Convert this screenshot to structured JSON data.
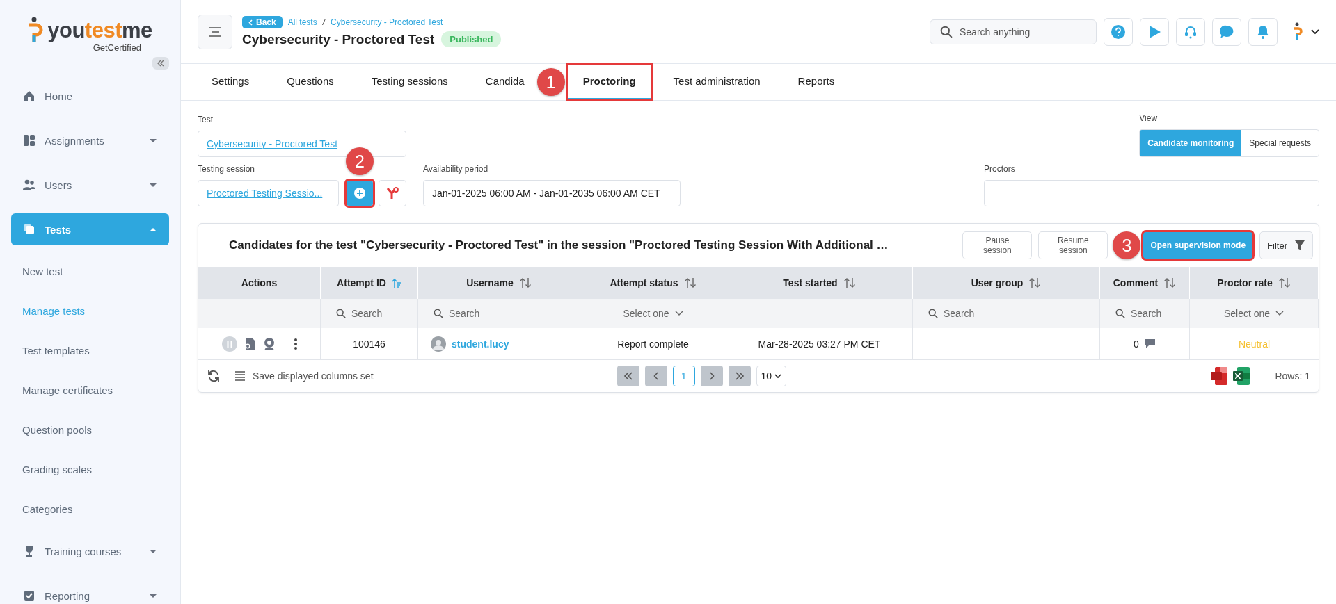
{
  "sidebar": {
    "brand": {
      "parts": [
        "you",
        "test",
        "me"
      ],
      "tagline": "GetCertified"
    },
    "items": [
      {
        "label": "Home",
        "selected": false
      },
      {
        "label": "Assignments",
        "selected": false,
        "expanded": false
      },
      {
        "label": "Users",
        "selected": false,
        "expanded": false
      },
      {
        "label": "Tests",
        "selected": true,
        "expanded": true,
        "children": [
          {
            "label": "New test",
            "selected": false
          },
          {
            "label": "Manage tests",
            "selected": true
          },
          {
            "label": "Test templates",
            "selected": false
          },
          {
            "label": "Manage certificates",
            "selected": false
          },
          {
            "label": "Question pools",
            "selected": false
          },
          {
            "label": "Grading scales",
            "selected": false
          },
          {
            "label": "Categories",
            "selected": false
          }
        ]
      },
      {
        "label": "Training courses",
        "selected": false,
        "expanded": false
      },
      {
        "label": "Reporting",
        "selected": false,
        "expanded": false
      }
    ]
  },
  "header": {
    "back": "Back",
    "breadcrumb": [
      "All tests",
      "/",
      "Cybersecurity - Proctored Test"
    ],
    "title": "Cybersecurity - Proctored Test",
    "status": "Published",
    "search": {
      "placeholder": "Search anything"
    }
  },
  "tabs": [
    {
      "label": "Settings",
      "selected": false
    },
    {
      "label": "Questions",
      "selected": false
    },
    {
      "label": "Testing sessions",
      "selected": false
    },
    {
      "label": "Candida",
      "selected": false
    },
    {
      "label": "Proctoring",
      "selected": true,
      "callout": "1"
    },
    {
      "label": "Test administration",
      "selected": false
    },
    {
      "label": "Reports",
      "selected": false
    }
  ],
  "form": {
    "test": {
      "label": "Test",
      "value": "Cybersecurity - Proctored Test"
    },
    "view": {
      "label": "View",
      "options": [
        {
          "label": "Candidate monitoring",
          "selected": true
        },
        {
          "label": "Special requests",
          "selected": false
        }
      ]
    },
    "session": {
      "label": "Testing session",
      "value": "Proctored Testing Sessio...",
      "add_callout": "2"
    },
    "availability": {
      "label": "Availability period",
      "value": "Jan-01-2025 06:00 AM - Jan-01-2035 06:00 AM CET"
    },
    "proctors": {
      "label": "Proctors"
    }
  },
  "table": {
    "title": "Candidates for the test \"Cybersecurity - Proctored Test\" in the session \"Proctored Testing Session With Additional …",
    "buttons": [
      {
        "label": "Pause session",
        "kind": "plain"
      },
      {
        "label": "Resume session",
        "kind": "plain"
      },
      {
        "label": "Open supervision mode",
        "kind": "primary",
        "callout": "3"
      },
      {
        "label": "Filter",
        "kind": "filter"
      }
    ],
    "columns": [
      {
        "label": "Actions",
        "filter": {
          "kind": "none"
        }
      },
      {
        "label": "Attempt ID",
        "sorted": true,
        "filter": {
          "kind": "search",
          "placeholder": "Search"
        }
      },
      {
        "label": "Username",
        "sorted": false,
        "filter": {
          "kind": "search",
          "placeholder": "Search"
        }
      },
      {
        "label": "Attempt status",
        "sorted": false,
        "filter": {
          "kind": "select",
          "placeholder": "Select one"
        }
      },
      {
        "label": "Test started",
        "sorted": false,
        "filter": {
          "kind": "none"
        }
      },
      {
        "label": "User group",
        "sorted": false,
        "filter": {
          "kind": "search",
          "placeholder": "Search"
        }
      },
      {
        "label": "Comment",
        "sorted": false,
        "filter": {
          "kind": "search",
          "placeholder": "Search"
        }
      },
      {
        "label": "Proctor rate",
        "sorted": false,
        "filter": {
          "kind": "select",
          "placeholder": "Select one"
        }
      }
    ],
    "rows": [
      {
        "attempt_id": "100146",
        "username": "student.lucy",
        "status": "Report complete",
        "started": "Mar-28-2025 03:27 PM CET",
        "comments": "0",
        "rate": "Neutral"
      }
    ],
    "footer": {
      "save_columns": "Save displayed columns set",
      "pages": [
        {
          "label": "1",
          "selected": true
        }
      ],
      "page_size": "10",
      "rows": "Rows: 1"
    }
  }
}
